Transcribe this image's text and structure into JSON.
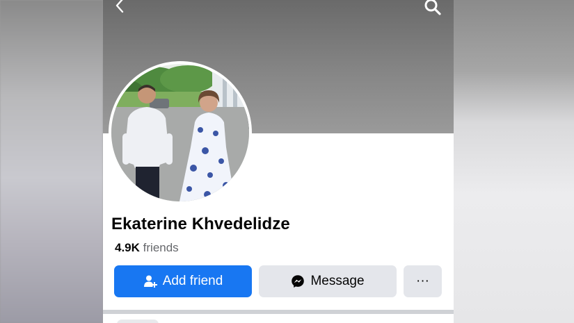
{
  "profile": {
    "name": "Ekaterine Khvedelidze",
    "friends_count": "4.9K",
    "friends_label": "friends"
  },
  "actions": {
    "add_friend_label": "Add friend",
    "message_label": "Message",
    "more_label": "···"
  },
  "icons": {
    "back": "chevron-left-icon",
    "search": "search-icon",
    "add_friend": "add-person-icon",
    "message": "messenger-icon"
  },
  "colors": {
    "primary": "#1877f2",
    "secondary_button": "#e4e6eb",
    "text": "#050505",
    "muted_text": "#65676b"
  }
}
